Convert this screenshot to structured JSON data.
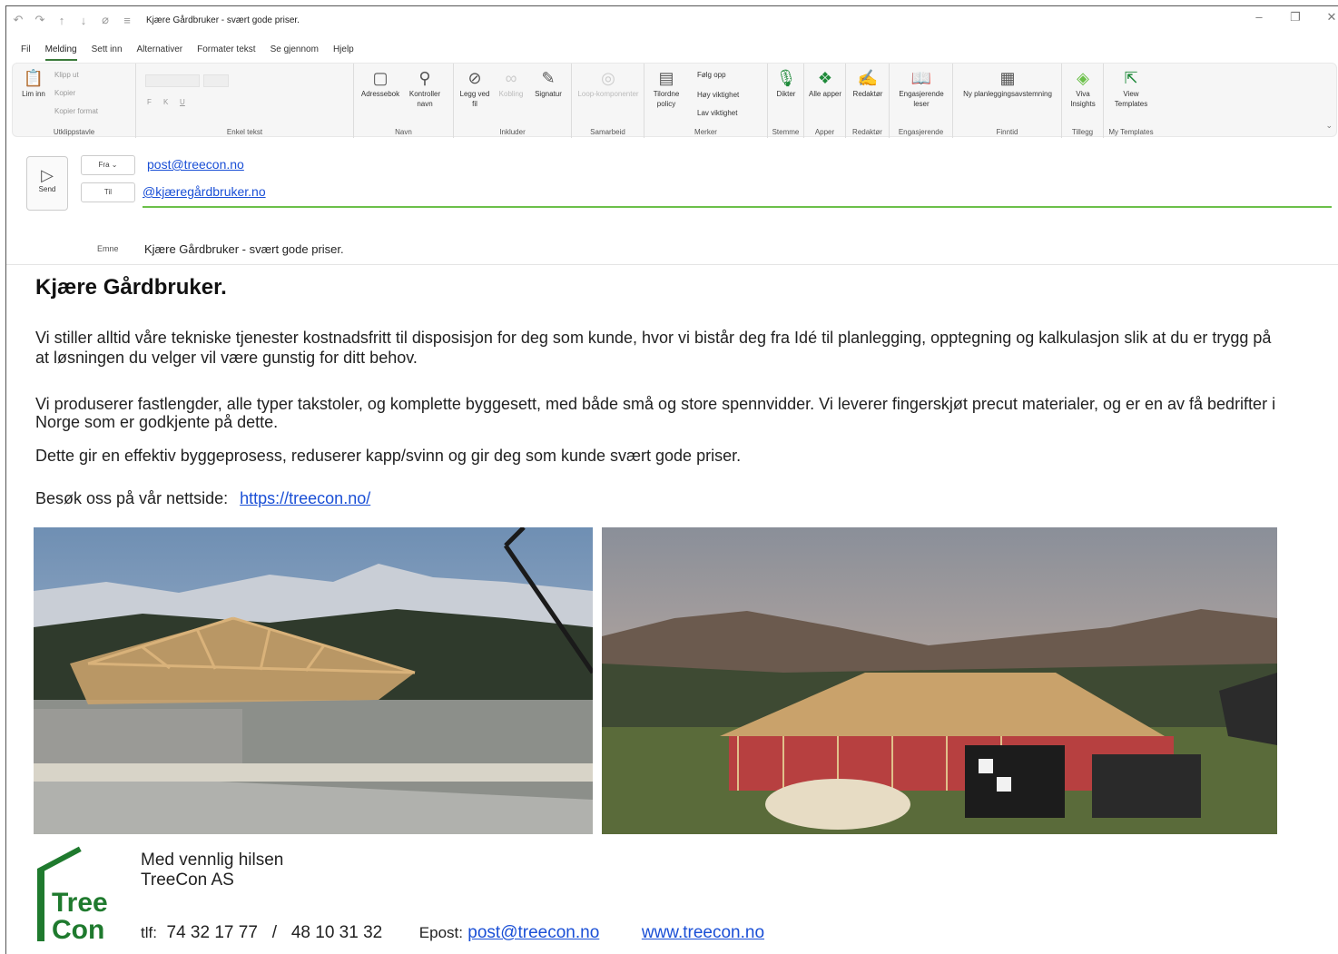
{
  "window": {
    "title": "Kjære Gårdbruker - svært gode priser."
  },
  "menu": {
    "tabs": [
      "Fil",
      "Melding",
      "Sett inn",
      "Alternativer",
      "Formater tekst",
      "Se gjennom",
      "Hjelp"
    ]
  },
  "ribbon": {
    "clipboard": {
      "paste": "Lim inn",
      "cut": "Klipp ut",
      "copy": "Kopier",
      "format_painter": "Kopier format",
      "label": "Utklippstavle"
    },
    "basic_text": {
      "label": "Enkel tekst",
      "bold": "F",
      "italic": "K",
      "underline": "U"
    },
    "names": {
      "address_book": "Adressebok",
      "check_names": "Kontroller navn",
      "label": "Navn"
    },
    "include": {
      "attach": "Legg ved fil",
      "link": "Kobling",
      "signature": "Signatur",
      "label": "Inkluder"
    },
    "collab": {
      "loop": "Loop-komponenter",
      "label": "Samarbeid"
    },
    "tags": {
      "policy": "Tilordne policy",
      "follow": "Følg opp",
      "high": "Høy viktighet",
      "low": "Lav viktighet",
      "label": "Merker"
    },
    "voice": {
      "dictate": "Dikter",
      "label": "Stemme"
    },
    "apps": {
      "all": "Alle apper",
      "label": "Apper"
    },
    "editor": {
      "editor": "Redaktør",
      "label": "Redaktør"
    },
    "engage": {
      "reader": "Engasjerende leser",
      "label": "Engasjerende"
    },
    "findtime": {
      "poll": "Ny planleggingsavstemning",
      "label": "Finntid"
    },
    "addins": {
      "viva": "Viva Insights",
      "label": "Tillegg"
    },
    "templates": {
      "view": "View Templates",
      "label": "My Templates"
    }
  },
  "compose": {
    "send_label": "Send",
    "from_button": "Fra",
    "from_address": "post@treecon.no",
    "to_button": "Til",
    "to_address": "@kjæregårdbruker.no",
    "subject_label": "Emne",
    "subject": "Kjære Gårdbruker - svært gode priser."
  },
  "body": {
    "greeting": "Kjære Gårdbruker.",
    "para1": "Vi stiller alltid våre tekniske tjenester kostnadsfritt til disposisjon for deg som kunde, hvor vi bistår deg fra Idé til planlegging, opptegning og kalkulasjon slik at du er trygg på at løsningen du velger vil være gunstig for ditt behov.",
    "para2": "Vi produserer fastlengder, alle typer takstoler, og komplette byggesett, med både små og store spennvidder. Vi leverer fingerskjøt precut materialer, og er en av få bedrifter i Norge som er godkjente på dette.",
    "para3": "Dette gir en effektiv byggeprosess, reduserer kapp/svinn og gir deg som kunde svært gode priser.",
    "visit_text": "Besøk oss på vår nettside:",
    "visit_link": "https://treecon.no/"
  },
  "signature": {
    "greeting": "Med vennlig hilsen",
    "company": "TreeCon AS",
    "logo_line1": "Tree",
    "logo_line2": "Con",
    "tlf_label": "tlf:",
    "phone1": "74 32 17 77",
    "separator": "/",
    "phone2": "48 10 31 32",
    "email_label": "Epost:",
    "email": "post@treecon.no",
    "website": "www.treecon.no"
  },
  "colors": {
    "accent": "#3a7a3a",
    "link": "#1a4fd6",
    "brand": "#1f7a2e"
  }
}
